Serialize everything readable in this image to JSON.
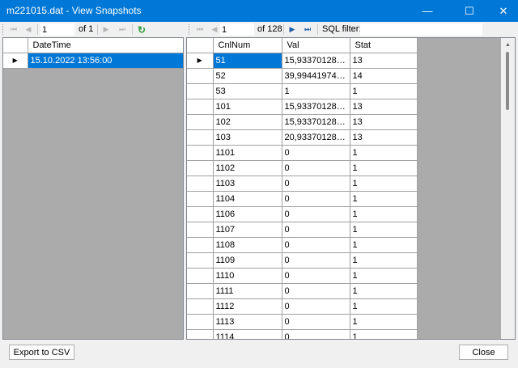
{
  "window": {
    "title": "m221015.dat - View Snapshots",
    "minimize_glyph": "—",
    "maximize_glyph": "☐",
    "close_glyph": "✕"
  },
  "left_nav": {
    "position": "1",
    "of_text": "of 1"
  },
  "right_nav": {
    "position": "1",
    "of_text": "of 128",
    "filter_label": "SQL filter:",
    "filter_value": ""
  },
  "icons": {
    "first": "⏮",
    "prev": "◀",
    "next": "▶",
    "last": "⏭",
    "refresh": "↻",
    "current_row": "▶",
    "scroll_up": "▲"
  },
  "snapshots_grid": {
    "column_header": "DateTime",
    "rows": [
      {
        "datetime": "15.10.2022 13:56:00",
        "selected": true
      }
    ]
  },
  "values_grid": {
    "columns": [
      "CnlNum",
      "Val",
      "Stat"
    ],
    "rows": [
      {
        "cnl": "51",
        "val": "15,93370128027...",
        "stat": "13",
        "selected": true
      },
      {
        "cnl": "52",
        "val": "39,99441974999...",
        "stat": "14"
      },
      {
        "cnl": "53",
        "val": "1",
        "stat": "1"
      },
      {
        "cnl": "101",
        "val": "15,93370128027...",
        "stat": "13"
      },
      {
        "cnl": "102",
        "val": "15,93370128027...",
        "stat": "13"
      },
      {
        "cnl": "103",
        "val": "20,93370128027...",
        "stat": "13"
      },
      {
        "cnl": "1101",
        "val": "0",
        "stat": "1"
      },
      {
        "cnl": "1102",
        "val": "0",
        "stat": "1"
      },
      {
        "cnl": "1103",
        "val": "0",
        "stat": "1"
      },
      {
        "cnl": "1104",
        "val": "0",
        "stat": "1"
      },
      {
        "cnl": "1106",
        "val": "0",
        "stat": "1"
      },
      {
        "cnl": "1107",
        "val": "0",
        "stat": "1"
      },
      {
        "cnl": "1108",
        "val": "0",
        "stat": "1"
      },
      {
        "cnl": "1109",
        "val": "0",
        "stat": "1"
      },
      {
        "cnl": "1110",
        "val": "0",
        "stat": "1"
      },
      {
        "cnl": "1111",
        "val": "0",
        "stat": "1"
      },
      {
        "cnl": "1112",
        "val": "0",
        "stat": "1"
      },
      {
        "cnl": "1113",
        "val": "0",
        "stat": "1"
      },
      {
        "cnl": "1114",
        "val": "0",
        "stat": "1"
      }
    ]
  },
  "footer": {
    "export_label": "Export to CSV",
    "close_label": "Close"
  },
  "colors": {
    "titlebar": "#0078d7",
    "selection": "#0078d7",
    "grid_background": "#ababab"
  }
}
